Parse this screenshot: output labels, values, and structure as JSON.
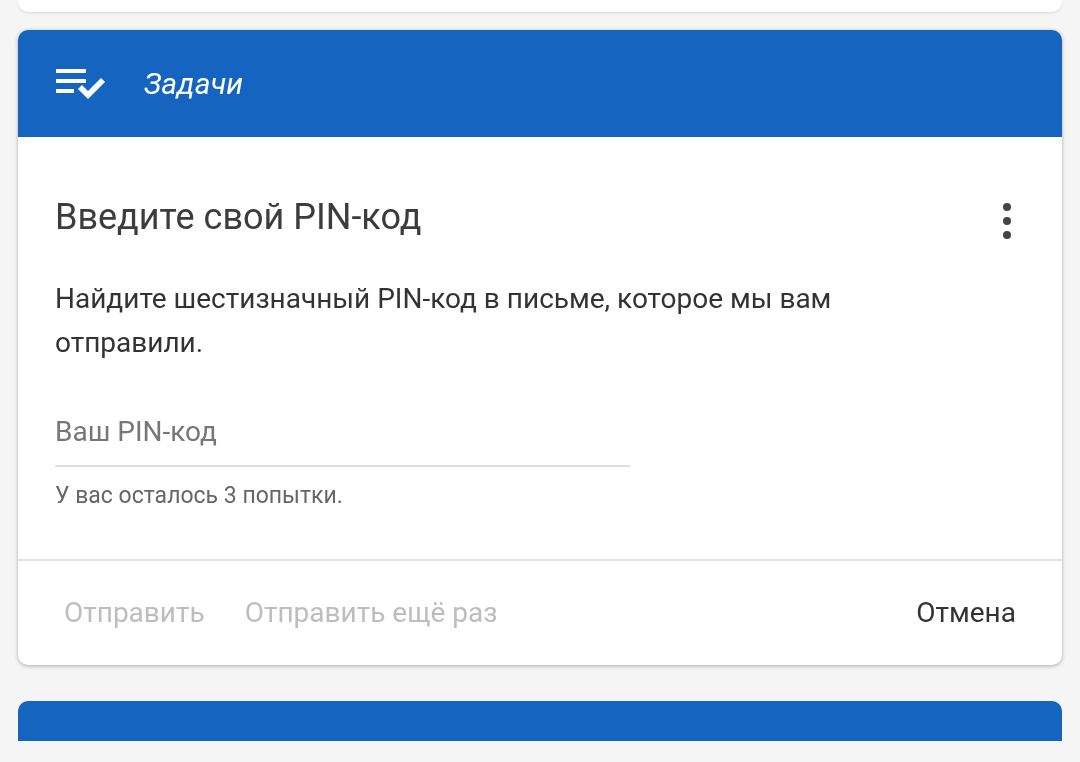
{
  "header": {
    "title": "Задачи"
  },
  "card": {
    "title": "Введите свой PIN-код",
    "description": "Найдите шестизначный PIN-код в письме, которое мы вам отправили.",
    "field": {
      "placeholder": "Ваш PIN-код"
    },
    "helper": "У вас осталось 3 попытки."
  },
  "buttons": [
    {
      "label": "Отправить",
      "disabled": true
    },
    {
      "label": "Отправить ещё раз",
      "disabled": true
    },
    {
      "label": "Отмена",
      "disabled": false
    }
  ]
}
